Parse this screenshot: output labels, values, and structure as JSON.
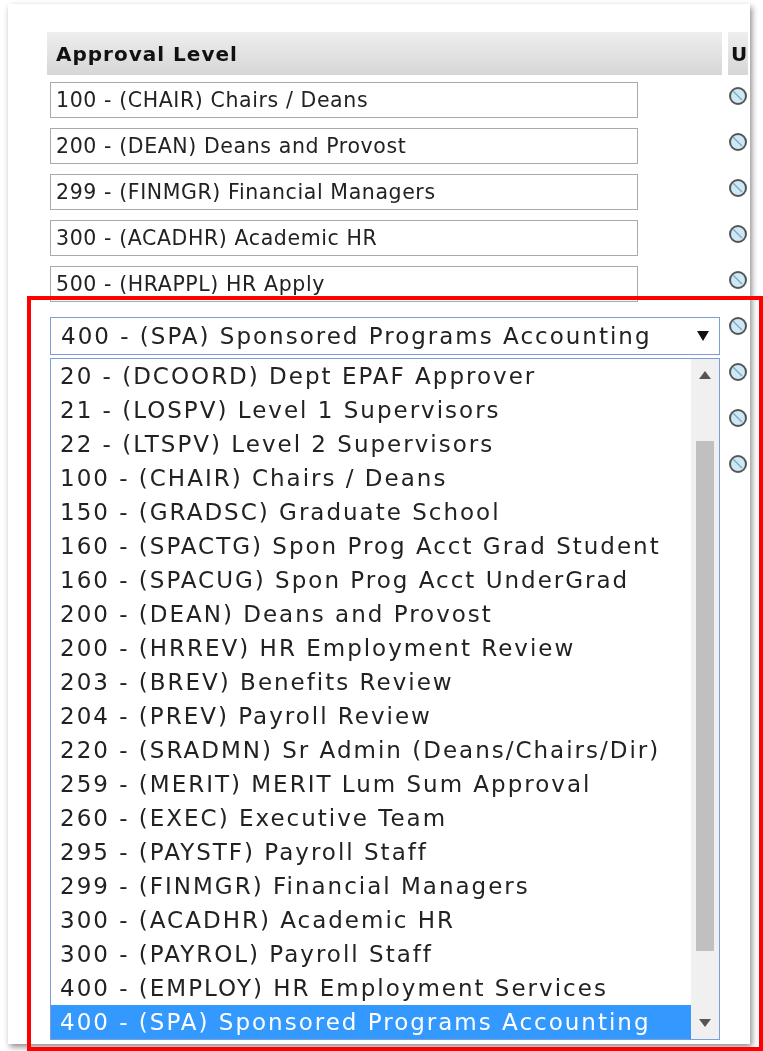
{
  "table": {
    "columns": [
      "Approval Level",
      "U"
    ],
    "rows": [
      {
        "kind": "field",
        "value": "100 - (CHAIR) Chairs / Deans"
      },
      {
        "kind": "field",
        "value": "200 - (DEAN) Deans and Provost"
      },
      {
        "kind": "field",
        "value": "299 - (FINMGR) Financial Managers"
      },
      {
        "kind": "field",
        "value": "300 - (ACADHR) Academic HR"
      },
      {
        "kind": "field",
        "value": "500 - (HRAPPL) HR Apply"
      },
      {
        "kind": "select",
        "value": "400 - (SPA) Sponsored Programs Accounting",
        "expanded": true,
        "options": [
          {
            "label": "20 - (DCOORD) Dept EPAF Approver",
            "selected": false
          },
          {
            "label": "21 - (LOSPV) Level 1 Supervisors",
            "selected": false
          },
          {
            "label": "22 - (LTSPV) Level 2 Supervisors",
            "selected": false
          },
          {
            "label": "100 - (CHAIR) Chairs / Deans",
            "selected": false
          },
          {
            "label": "150 - (GRADSC) Graduate School",
            "selected": false
          },
          {
            "label": "160 - (SPACTG) Spon Prog Acct Grad Student",
            "selected": false
          },
          {
            "label": "160 - (SPACUG) Spon Prog Acct UnderGrad",
            "selected": false
          },
          {
            "label": "200 - (DEAN) Deans and Provost",
            "selected": false
          },
          {
            "label": "200 - (HRREV) HR Employment Review",
            "selected": false
          },
          {
            "label": "203 - (BREV) Benefits Review",
            "selected": false
          },
          {
            "label": "204 - (PREV) Payroll Review",
            "selected": false
          },
          {
            "label": "220 - (SRADMN) Sr Admin (Deans/Chairs/Dir)",
            "selected": false
          },
          {
            "label": "259 - (MERIT) MERIT Lum Sum Approval",
            "selected": false
          },
          {
            "label": "260 - (EXEC) Executive Team",
            "selected": false
          },
          {
            "label": "295 - (PAYSTF) Payroll Staff",
            "selected": false
          },
          {
            "label": "299 - (FINMGR) Financial Managers",
            "selected": false
          },
          {
            "label": "300 - (ACADHR) Academic HR",
            "selected": false
          },
          {
            "label": "300 - (PAYROL) Payroll Staff",
            "selected": false
          },
          {
            "label": "400 - (EMPLOY) HR Employment Services",
            "selected": false
          },
          {
            "label": "400 - (SPA) Sponsored Programs Accounting",
            "selected": true
          }
        ]
      },
      {
        "kind": "covered"
      },
      {
        "kind": "covered"
      },
      {
        "kind": "covered"
      }
    ]
  },
  "highlight": {
    "color": "#ff0000"
  }
}
